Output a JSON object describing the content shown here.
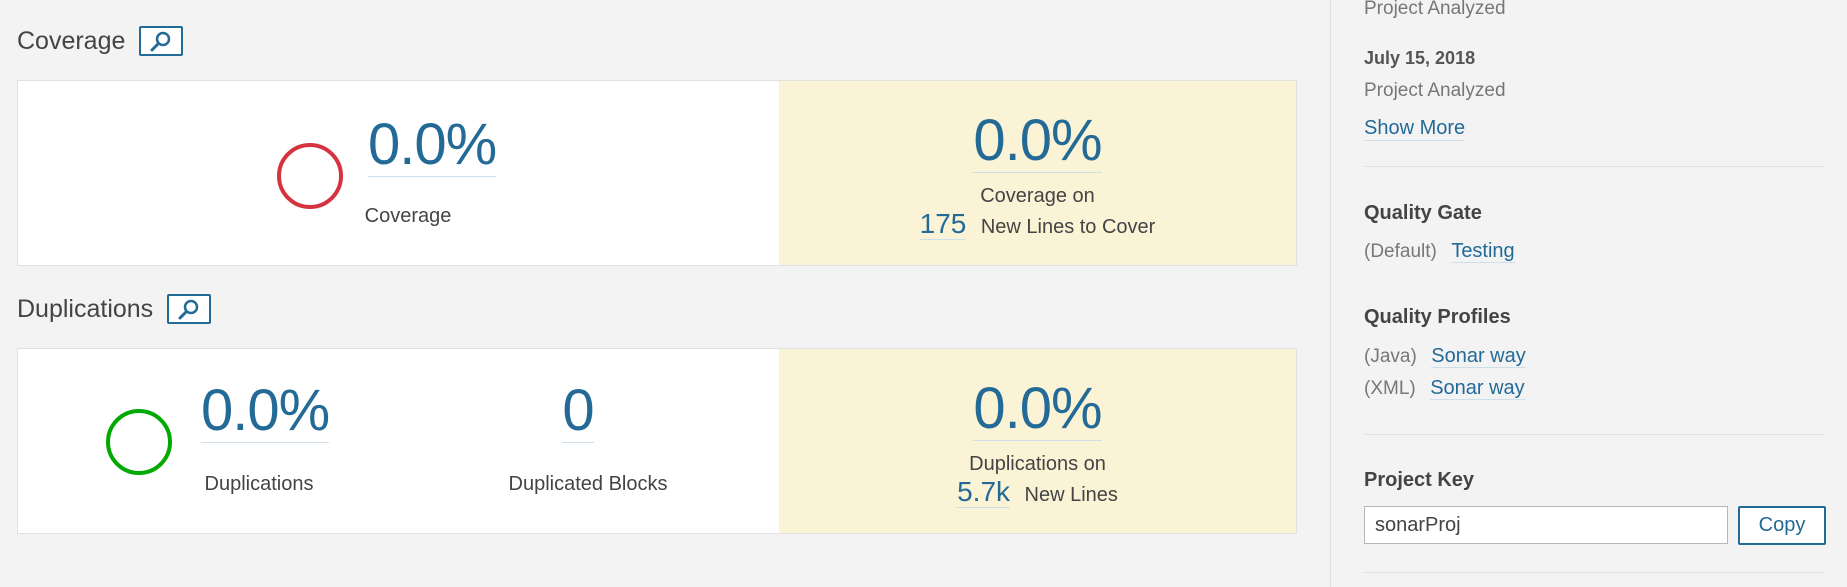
{
  "coverage": {
    "title": "Coverage",
    "value": "0.0%",
    "label": "Coverage",
    "new_value": "0.0%",
    "new_label": "Coverage on",
    "new_lines_count": "175",
    "new_lines_label": "New Lines to Cover"
  },
  "duplications": {
    "title": "Duplications",
    "value": "0.0%",
    "label": "Duplications",
    "blocks_value": "0",
    "blocks_label": "Duplicated Blocks",
    "new_value": "0.0%",
    "new_label": "Duplications on",
    "new_lines_count": "5.7k",
    "new_lines_label": "New Lines"
  },
  "sidebar": {
    "analysis_top_label": "Project Analyzed",
    "analysis_date": "July 15, 2018",
    "analysis_label": "Project Analyzed",
    "show_more": "Show More",
    "quality_gate": {
      "heading": "Quality Gate",
      "qualifier": "(Default)",
      "name": "Testing"
    },
    "quality_profiles": {
      "heading": "Quality Profiles",
      "items": [
        {
          "language": "(Java)",
          "name": "Sonar way"
        },
        {
          "language": "(XML)",
          "name": "Sonar way"
        }
      ]
    },
    "project_key": {
      "heading": "Project Key",
      "value": "sonarProj",
      "copy_label": "Copy"
    }
  },
  "colors": {
    "accent": "#236a97",
    "rating_bad": "#d4333f",
    "rating_good": "#00aa00",
    "leak_period": "#fbf3d5"
  },
  "icons": {
    "history": "history-icon"
  }
}
